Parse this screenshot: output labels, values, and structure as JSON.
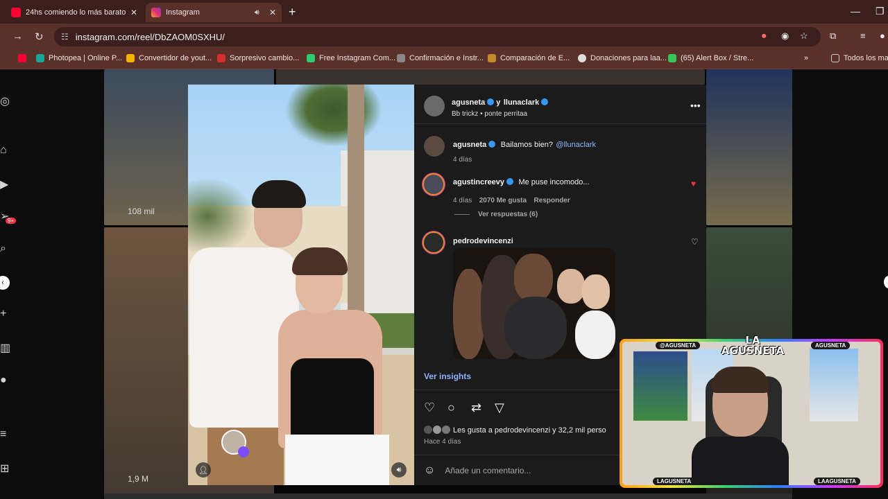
{
  "browser": {
    "tabs": [
      {
        "title": "24hs comiendo lo más barato d",
        "favicon_color": "#ff0033"
      },
      {
        "title": "Instagram",
        "favicon_color": "#e1306c"
      }
    ],
    "url": "instagram.com/reel/DbZAOM0SXHU/",
    "bookmarks": [
      {
        "label": "",
        "color": "#ff0033"
      },
      {
        "label": "Photopea | Online P...",
        "color": "#18a497"
      },
      {
        "label": "Convertidor de yout...",
        "color": "#f4b400"
      },
      {
        "label": "Sorpresivo cambio...",
        "color": "#d32f2f"
      },
      {
        "label": "Free Instagram Com...",
        "color": "#2ecc71"
      },
      {
        "label": "Confirmación e Instr...",
        "color": "#888888"
      },
      {
        "label": "Comparación de E...",
        "color": "#c58a2a"
      },
      {
        "label": "Donaciones para laa...",
        "color": "#dddddd"
      },
      {
        "label": "(65) Alert Box / Stre...",
        "color": "#34c759"
      },
      {
        "label": "Todos los mar",
        "color": "#cccccc"
      }
    ]
  },
  "sidebar": {
    "notification_count": "9+"
  },
  "background_tiles": {
    "views_1": "108 mil",
    "views_2": "1,9 M"
  },
  "post": {
    "header_user": "agusneta",
    "header_joiner": "y",
    "header_collab": "llunaclark",
    "header_audio": "Bb trickz • ponte perritaa",
    "caption_user": "agusneta",
    "caption_text": "Bailamos bien?",
    "caption_mention": "@llunaclark",
    "caption_time": "4 días",
    "comments": [
      {
        "user": "agustincreevy",
        "text": "Me puse incomodo...",
        "time": "4 días",
        "likes": "2070 Me gusta",
        "reply": "Responder",
        "view_replies": "Ver respuestas (6)"
      },
      {
        "user": "pedrodevincenzi",
        "text": ""
      }
    ],
    "insights": "Ver insights",
    "likes_text": "Les gusta a pedrodevincenzi y 32,2 mil perso",
    "posted": "Hace 4 días",
    "comment_placeholder": "Añade un comentario..."
  },
  "stream_overlay": {
    "handle_top_left": "@AGUSNETA",
    "handle_top_right": "AGUSNETA",
    "logo": "LA AGUSNETA",
    "handle_bottom_left": "LAGUSNETA",
    "handle_bottom_right": "LAAGUSNETA"
  }
}
